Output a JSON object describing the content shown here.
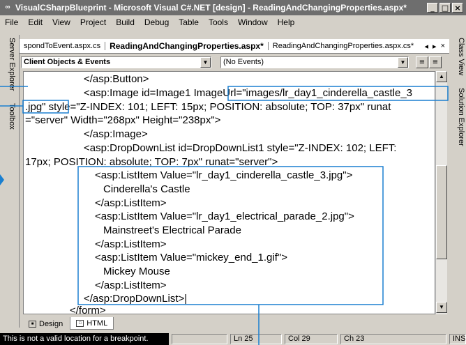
{
  "window": {
    "title": "VisualCSharpBlueprint - Microsoft Visual C#.NET [design] - ReadingAndChangingProperties.aspx*",
    "controls": {
      "minimize": "_",
      "restore": "□",
      "close": "×"
    }
  },
  "menu": {
    "items": [
      "File",
      "Edit",
      "View",
      "Project",
      "Build",
      "Debug",
      "Table",
      "Tools",
      "Window",
      "Help"
    ]
  },
  "docks": {
    "left": [
      "Server Explorer",
      "Toolbox"
    ],
    "right": [
      "Class View",
      "Solution Explorer"
    ]
  },
  "tabs": {
    "items": [
      {
        "label": "spondToEvent.aspx.cs",
        "active": false
      },
      {
        "label": "ReadingAndChangingProperties.aspx*",
        "active": true
      },
      {
        "label": "ReadingAndChangingProperties.aspx.cs*",
        "active": false
      }
    ],
    "nav": {
      "prev": "◂",
      "next": "▸",
      "close": "×"
    }
  },
  "combos": {
    "objects": {
      "value": "Client Objects & Events"
    },
    "events": {
      "value": "(No Events)"
    }
  },
  "code": {
    "lines": [
      "</asp:Button>",
      "<asp:Image id=Image1 ImageUrl=\"images/lr_day1_cinderella_castle_3",
      ".jpg\" style=\"Z-INDEX: 101; LEFT: 15px; POSITION: absolute; TOP: 37px\" runat",
      "=\"server\" Width=\"268px\" Height=\"238px\">",
      "</asp:Image>",
      "<asp:DropDownList id=DropDownList1 style=\"Z-INDEX: 102; LEFT:",
      "17px; POSITION: absolute; TOP: 7px\" runat=\"server\">",
      "<asp:ListItem Value=\"lr_day1_cinderella_castle_3.jpg\">",
      "Cinderella's Castle",
      "</asp:ListItem>",
      "<asp:ListItem Value=\"lr_day1_electrical_parade_2.jpg\">",
      "Mainstreet's Electrical Parade",
      "</asp:ListItem>",
      "<asp:ListItem Value=\"mickey_end_1.gif\">",
      "Mickey Mouse",
      "</asp:ListItem>",
      "</asp:DropDownList>|",
      "</form>"
    ]
  },
  "view_tabs": {
    "design": "Design",
    "html": "HTML"
  },
  "status": {
    "message": "This is not a valid location for a breakpoint.",
    "ln": "Ln 25",
    "col": "Col 29",
    "ch": "Ch 23",
    "mode": "INS"
  }
}
